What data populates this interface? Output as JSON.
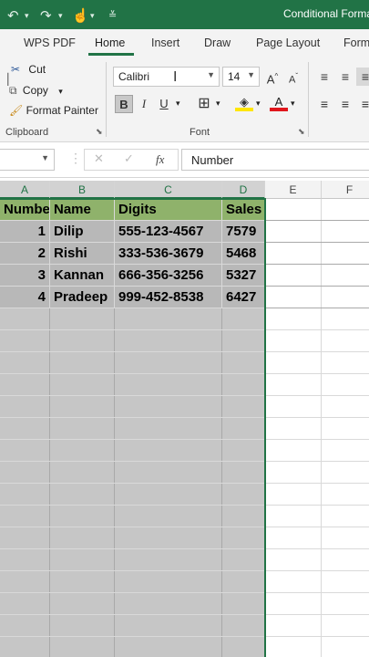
{
  "app": {
    "title": "Conditional Forma",
    "accent": "#217346"
  },
  "quick_access": {
    "undo_icon": "undo-icon",
    "redo_icon": "redo-icon",
    "touch_icon": "touch-mode-icon",
    "customize_icon": "customize-icon"
  },
  "tabs": [
    "WPS PDF",
    "Home",
    "Insert",
    "Draw",
    "Page Layout",
    "Form"
  ],
  "active_tab": "Home",
  "clipboard": {
    "cut": "Cut",
    "copy": "Copy",
    "format_painter": "Format Painter",
    "label": "Clipboard"
  },
  "font": {
    "name": "Calibri",
    "size": "14",
    "bold": "B",
    "italic": "I",
    "underline": "U",
    "label": "Font",
    "grow": "A",
    "shrink": "A",
    "font_color": "A"
  },
  "formula_bar": {
    "fx": "fx",
    "content": "Number"
  },
  "columns": [
    "A",
    "B",
    "C",
    "D",
    "E",
    "F"
  ],
  "table": {
    "headers": [
      "Number",
      "Name",
      "Digits",
      "Sales"
    ],
    "rows": [
      [
        "1",
        "Dilip",
        "555-123-4567",
        "7579"
      ],
      [
        "2",
        "Rishi",
        "333-536-3679",
        "5468"
      ],
      [
        "3",
        "Kannan",
        "666-356-3256",
        "5327"
      ],
      [
        "4",
        "Pradeep",
        "999-452-8538",
        "6427"
      ]
    ]
  },
  "colors": {
    "header_fill": "#8fb26b",
    "selection_fill": "#c6c6c6",
    "data_fill": "#b8b8b8"
  }
}
